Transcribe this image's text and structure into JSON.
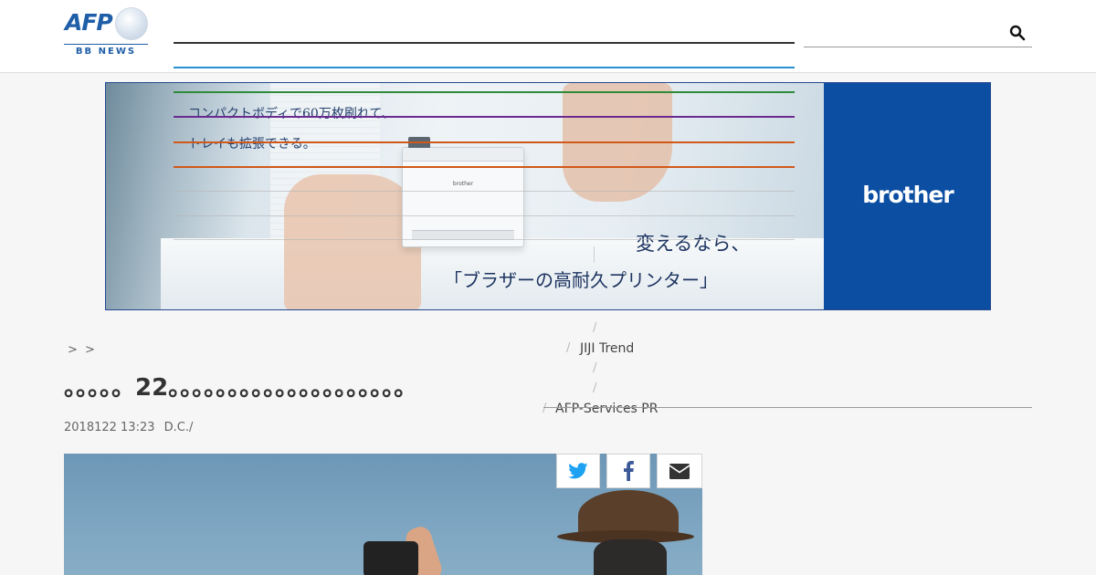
{
  "header": {
    "logo_text": "AFP",
    "logo_sub": "BB NEWS",
    "search": {
      "placeholder": "",
      "value": ""
    }
  },
  "banner": {
    "copy_line1": "コンパクトボディで60万枚刷れて、",
    "copy_line2": "トレイも拡張できる。",
    "headline1": "変えるなら、",
    "headline2": "「ブラザーの高耐久プリンター」",
    "brand": "brother",
    "printer_brand": "brother"
  },
  "nav": {
    "links": [
      "JIJI Trend",
      "AFP-Services PR"
    ],
    "separator": "/"
  },
  "breadcrumb": "> >",
  "article": {
    "title": "。。。。。22。。。。。。。。。。。。。。。。。。。。",
    "date": "2018122 13:23",
    "credit": "D.C./"
  },
  "colors": {
    "brand_blue": "#1f5ea8",
    "brother_blue": "#0b4ea2",
    "rule_green": "#2e8b3a",
    "rule_purple": "#6a2a8f",
    "rule_orange": "#d0591a",
    "rule_blue": "#2a8fd0",
    "twitter": "#1da1f2",
    "facebook": "#3b5998"
  },
  "icons": {
    "search": "search-icon",
    "twitter": "twitter-icon",
    "facebook": "facebook-icon",
    "mail": "mail-icon"
  }
}
